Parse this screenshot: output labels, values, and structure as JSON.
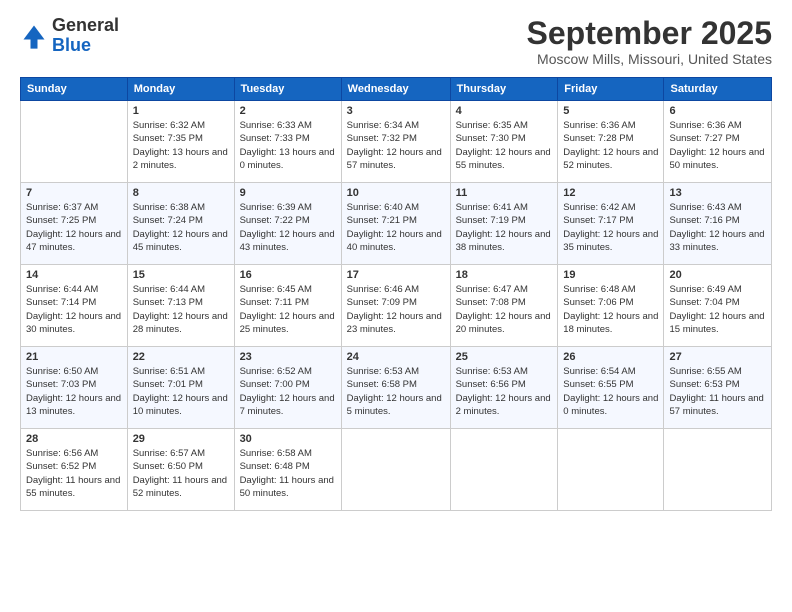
{
  "logo": {
    "general": "General",
    "blue": "Blue"
  },
  "header": {
    "month": "September 2025",
    "location": "Moscow Mills, Missouri, United States"
  },
  "weekdays": [
    "Sunday",
    "Monday",
    "Tuesday",
    "Wednesday",
    "Thursday",
    "Friday",
    "Saturday"
  ],
  "weeks": [
    [
      {
        "day": "",
        "info": ""
      },
      {
        "day": "1",
        "info": "Sunrise: 6:32 AM\nSunset: 7:35 PM\nDaylight: 13 hours\nand 2 minutes."
      },
      {
        "day": "2",
        "info": "Sunrise: 6:33 AM\nSunset: 7:33 PM\nDaylight: 13 hours\nand 0 minutes."
      },
      {
        "day": "3",
        "info": "Sunrise: 6:34 AM\nSunset: 7:32 PM\nDaylight: 12 hours\nand 57 minutes."
      },
      {
        "day": "4",
        "info": "Sunrise: 6:35 AM\nSunset: 7:30 PM\nDaylight: 12 hours\nand 55 minutes."
      },
      {
        "day": "5",
        "info": "Sunrise: 6:36 AM\nSunset: 7:28 PM\nDaylight: 12 hours\nand 52 minutes."
      },
      {
        "day": "6",
        "info": "Sunrise: 6:36 AM\nSunset: 7:27 PM\nDaylight: 12 hours\nand 50 minutes."
      }
    ],
    [
      {
        "day": "7",
        "info": "Sunrise: 6:37 AM\nSunset: 7:25 PM\nDaylight: 12 hours\nand 47 minutes."
      },
      {
        "day": "8",
        "info": "Sunrise: 6:38 AM\nSunset: 7:24 PM\nDaylight: 12 hours\nand 45 minutes."
      },
      {
        "day": "9",
        "info": "Sunrise: 6:39 AM\nSunset: 7:22 PM\nDaylight: 12 hours\nand 43 minutes."
      },
      {
        "day": "10",
        "info": "Sunrise: 6:40 AM\nSunset: 7:21 PM\nDaylight: 12 hours\nand 40 minutes."
      },
      {
        "day": "11",
        "info": "Sunrise: 6:41 AM\nSunset: 7:19 PM\nDaylight: 12 hours\nand 38 minutes."
      },
      {
        "day": "12",
        "info": "Sunrise: 6:42 AM\nSunset: 7:17 PM\nDaylight: 12 hours\nand 35 minutes."
      },
      {
        "day": "13",
        "info": "Sunrise: 6:43 AM\nSunset: 7:16 PM\nDaylight: 12 hours\nand 33 minutes."
      }
    ],
    [
      {
        "day": "14",
        "info": "Sunrise: 6:44 AM\nSunset: 7:14 PM\nDaylight: 12 hours\nand 30 minutes."
      },
      {
        "day": "15",
        "info": "Sunrise: 6:44 AM\nSunset: 7:13 PM\nDaylight: 12 hours\nand 28 minutes."
      },
      {
        "day": "16",
        "info": "Sunrise: 6:45 AM\nSunset: 7:11 PM\nDaylight: 12 hours\nand 25 minutes."
      },
      {
        "day": "17",
        "info": "Sunrise: 6:46 AM\nSunset: 7:09 PM\nDaylight: 12 hours\nand 23 minutes."
      },
      {
        "day": "18",
        "info": "Sunrise: 6:47 AM\nSunset: 7:08 PM\nDaylight: 12 hours\nand 20 minutes."
      },
      {
        "day": "19",
        "info": "Sunrise: 6:48 AM\nSunset: 7:06 PM\nDaylight: 12 hours\nand 18 minutes."
      },
      {
        "day": "20",
        "info": "Sunrise: 6:49 AM\nSunset: 7:04 PM\nDaylight: 12 hours\nand 15 minutes."
      }
    ],
    [
      {
        "day": "21",
        "info": "Sunrise: 6:50 AM\nSunset: 7:03 PM\nDaylight: 12 hours\nand 13 minutes."
      },
      {
        "day": "22",
        "info": "Sunrise: 6:51 AM\nSunset: 7:01 PM\nDaylight: 12 hours\nand 10 minutes."
      },
      {
        "day": "23",
        "info": "Sunrise: 6:52 AM\nSunset: 7:00 PM\nDaylight: 12 hours\nand 7 minutes."
      },
      {
        "day": "24",
        "info": "Sunrise: 6:53 AM\nSunset: 6:58 PM\nDaylight: 12 hours\nand 5 minutes."
      },
      {
        "day": "25",
        "info": "Sunrise: 6:53 AM\nSunset: 6:56 PM\nDaylight: 12 hours\nand 2 minutes."
      },
      {
        "day": "26",
        "info": "Sunrise: 6:54 AM\nSunset: 6:55 PM\nDaylight: 12 hours\nand 0 minutes."
      },
      {
        "day": "27",
        "info": "Sunrise: 6:55 AM\nSunset: 6:53 PM\nDaylight: 11 hours\nand 57 minutes."
      }
    ],
    [
      {
        "day": "28",
        "info": "Sunrise: 6:56 AM\nSunset: 6:52 PM\nDaylight: 11 hours\nand 55 minutes."
      },
      {
        "day": "29",
        "info": "Sunrise: 6:57 AM\nSunset: 6:50 PM\nDaylight: 11 hours\nand 52 minutes."
      },
      {
        "day": "30",
        "info": "Sunrise: 6:58 AM\nSunset: 6:48 PM\nDaylight: 11 hours\nand 50 minutes."
      },
      {
        "day": "",
        "info": ""
      },
      {
        "day": "",
        "info": ""
      },
      {
        "day": "",
        "info": ""
      },
      {
        "day": "",
        "info": ""
      }
    ]
  ]
}
